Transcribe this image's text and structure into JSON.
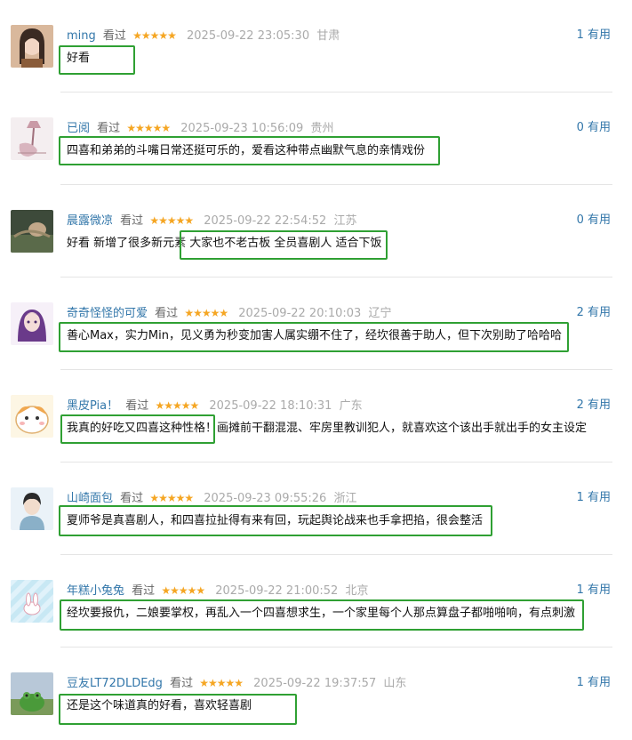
{
  "comments": [
    {
      "user": "ming",
      "watched": "看过",
      "stars": "★★★★★",
      "time": "2025-09-22 23:05:30",
      "location": "甘肃",
      "useful": "1 有用",
      "text": "好看",
      "avatar": "woman-portrait"
    },
    {
      "user": "已阅",
      "watched": "看过",
      "stars": "★★★★★",
      "time": "2025-09-23 10:56:09",
      "location": "贵州",
      "useful": "0 有用",
      "text": "四喜和弟弟的斗嘴日常还挺可乐的，爱看这种带点幽默气息的亲情戏份",
      "avatar": "lamp-sketch"
    },
    {
      "user": "晨露微凉",
      "watched": "看过",
      "stars": "★★★★★",
      "time": "2025-09-22 22:54:52",
      "location": "江苏",
      "useful": "0 有用",
      "text": "好看 新增了很多新元素 大家也不老古板 全员喜剧人 适合下饭",
      "avatar": "dark-photo"
    },
    {
      "user": "奇奇怪怪的可爱",
      "watched": "看过",
      "stars": "★★★★★",
      "time": "2025-09-22 20:10:03",
      "location": "辽宁",
      "useful": "2 有用",
      "text": "善心Max，实力Min，见义勇为秒变加害人属实绷不住了，经坎很善于助人，但下次别助了哈哈哈",
      "avatar": "anime-girl"
    },
    {
      "user": "黑皮Pia！",
      "watched": "看过",
      "stars": "★★★★★",
      "time": "2025-09-22 18:10:31",
      "location": "广东",
      "useful": "2 有用",
      "text": "我真的好吃又四喜这种性格！画摊前干翻混混、牢房里教训犯人，就喜欢这个该出手就出手的女主设定",
      "avatar": "hamster"
    },
    {
      "user": "山崎面包",
      "watched": "看过",
      "stars": "★★★★★",
      "time": "2025-09-23 09:55:26",
      "location": "浙江",
      "useful": "1 有用",
      "text": "夏师爷是真喜剧人，和四喜拉扯得有来有回，玩起舆论战来也手拿把掐，很会整活",
      "avatar": "boy-portrait"
    },
    {
      "user": "年糕小兔兔",
      "watched": "看过",
      "stars": "★★★★★",
      "time": "2025-09-22 21:00:52",
      "location": "北京",
      "useful": "1 有用",
      "text": "经坎要报仇，二娘要掌权，再乱入一个四喜想求生，一个家里每个人那点算盘子都啪啪响，有点刺激",
      "avatar": "bunny"
    },
    {
      "user": "豆友LT72DLDEdg",
      "watched": "看过",
      "stars": "★★★★★",
      "time": "2025-09-22 19:37:57",
      "location": "山东",
      "useful": "1 有用",
      "text": "还是这个味道真的好看，喜欢轻喜剧",
      "avatar": "frog"
    }
  ]
}
